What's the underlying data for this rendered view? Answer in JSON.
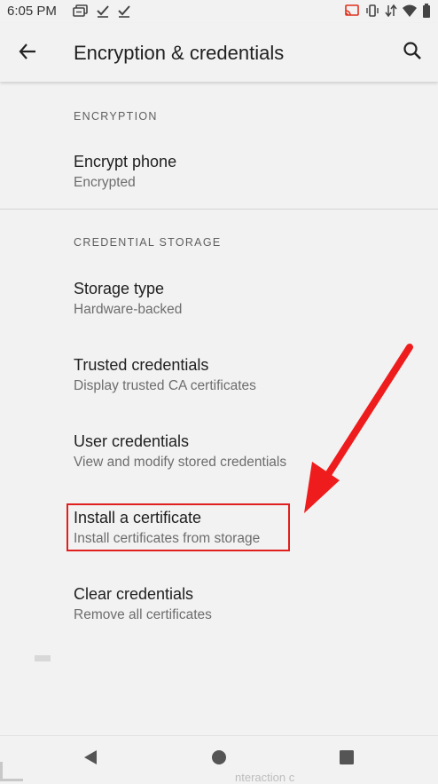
{
  "status_bar": {
    "time": "6:05 PM",
    "left_icons": [
      "screen-share-icon",
      "checkmark-icon",
      "checkmark-icon"
    ],
    "right_icons": [
      "cast-icon",
      "vibrate-icon",
      "data-saver-icon",
      "wifi-icon",
      "battery-icon"
    ]
  },
  "app_bar": {
    "title": "Encryption & credentials",
    "back_icon": "arrow-back-icon",
    "search_icon": "search-icon"
  },
  "sections": {
    "encryption": {
      "header": "ENCRYPTION",
      "items": [
        {
          "title": "Encrypt phone",
          "summary": "Encrypted"
        }
      ]
    },
    "credential_storage": {
      "header": "CREDENTIAL STORAGE",
      "items": [
        {
          "title": "Storage type",
          "summary": "Hardware-backed"
        },
        {
          "title": "Trusted credentials",
          "summary": "Display trusted CA certificates"
        },
        {
          "title": "User credentials",
          "summary": "View and modify stored credentials"
        },
        {
          "title": "Install a certificate",
          "summary": "Install certificates from storage"
        },
        {
          "title": "Clear credentials",
          "summary": "Remove all certificates"
        }
      ]
    }
  },
  "annotation": {
    "color": "#e0201e",
    "target": "Install a certificate"
  },
  "nav_bar": {
    "icons": [
      "nav-back-icon",
      "nav-home-icon",
      "nav-recents-icon"
    ],
    "ghost_text": "nteraction c"
  }
}
